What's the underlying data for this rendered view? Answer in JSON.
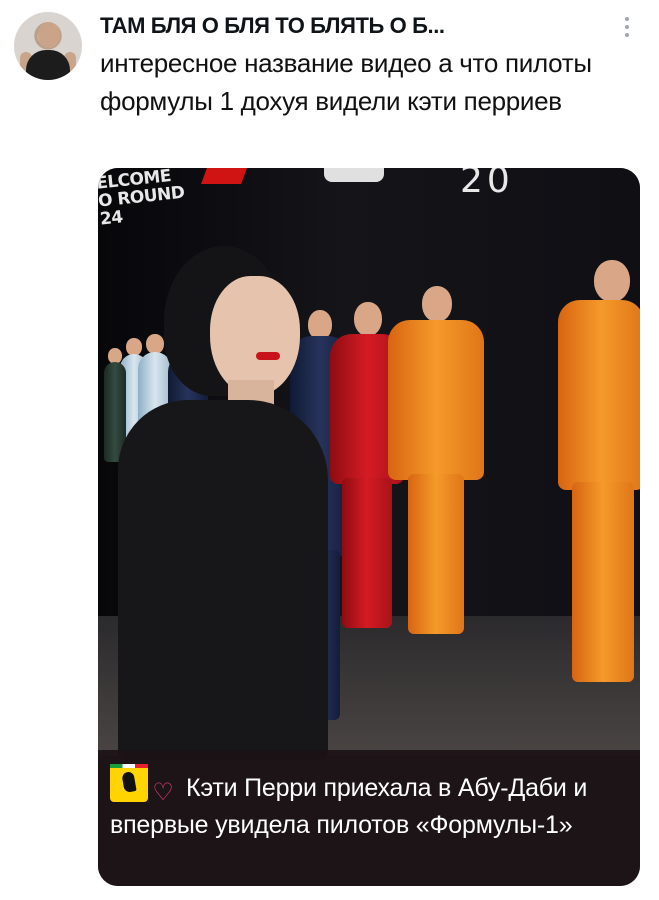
{
  "post": {
    "author_name": "ТАМ БЛЯ О БЛЯ ТО БЛЯТЬ О Б...",
    "text": "интересное название видео а что пилоты формулы 1 дохуя видели кэти перриев",
    "media": {
      "sign_text_line1": "ELCOME",
      "sign_text_line2": "O ROUND 24",
      "year_text": "20",
      "caption_text": "Кэти Перри приехала в Абу-Даби и впервые увидела пилотов «Формулы-1»"
    }
  },
  "icons": {
    "more": "more-vertical-icon",
    "caption_badge": "ferrari-logo-icon",
    "caption_heart": "heart-icon"
  },
  "colors": {
    "text": "#0f1419",
    "caption_bg": "#1c1216",
    "more_dots": "#a0a7ad"
  }
}
